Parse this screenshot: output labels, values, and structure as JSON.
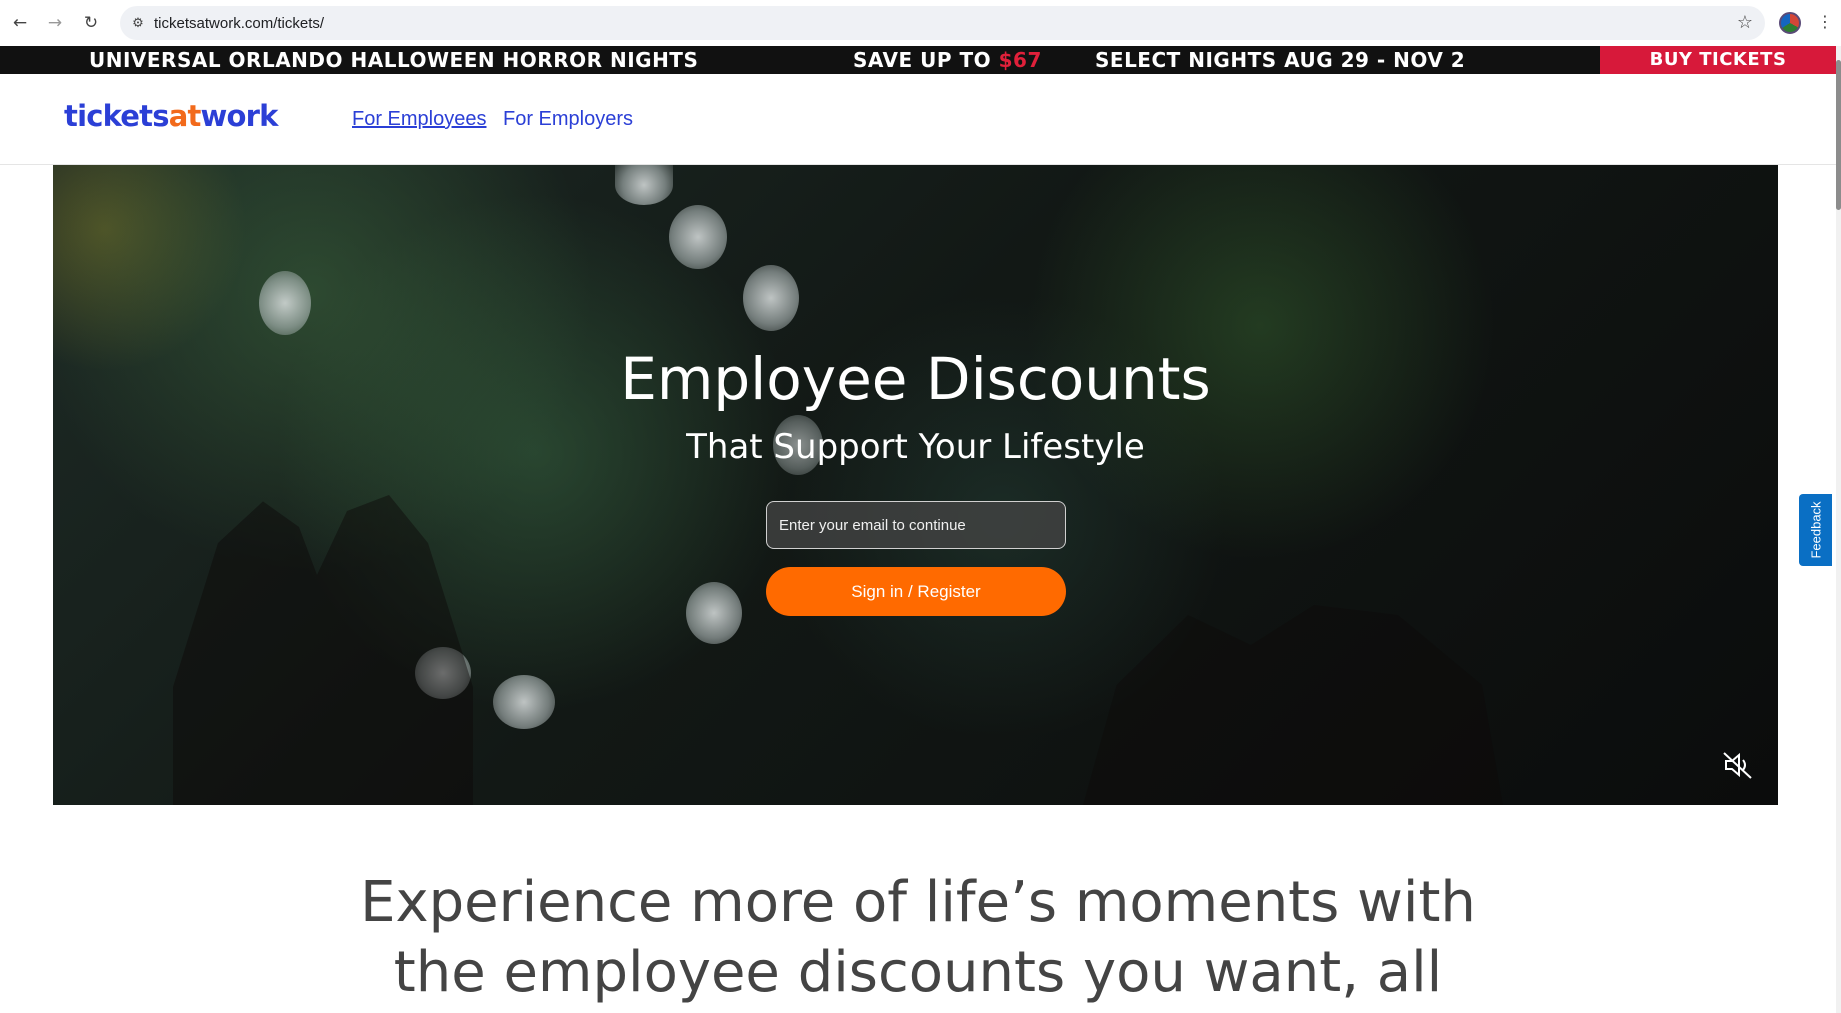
{
  "browser": {
    "url": "ticketsatwork.com/tickets/",
    "back_icon": "arrow-left-icon",
    "forward_icon": "arrow-right-icon",
    "reload_icon": "reload-icon"
  },
  "promo": {
    "event": "UNIVERSAL ORLANDO HALLOWEEN HORROR NIGHTS",
    "save_prefix": "SAVE UP TO",
    "save_amount": "$67",
    "dates": "SELECT NIGHTS AUG 29 - NOV 2",
    "cta": "BUY TICKETS",
    "accent_color": "#d7193a"
  },
  "header": {
    "logo_part1": "tickets",
    "logo_part2": "at",
    "logo_part3": "work",
    "nav": [
      {
        "label": "For Employees",
        "active": true
      },
      {
        "label": "For Employers",
        "active": false
      }
    ]
  },
  "hero": {
    "title": "Employee Discounts",
    "subtitle": "That Support Your Lifestyle",
    "email_placeholder": "Enter your email to continue",
    "signin_label": "Sign in / Register",
    "button_color": "#ff6a00",
    "mute_icon": "volume-muted-icon"
  },
  "feedback": {
    "label": "Feedback"
  },
  "tagline": {
    "line1": "Experience more of life’s moments with",
    "line2": "the employee discounts you want, all"
  }
}
